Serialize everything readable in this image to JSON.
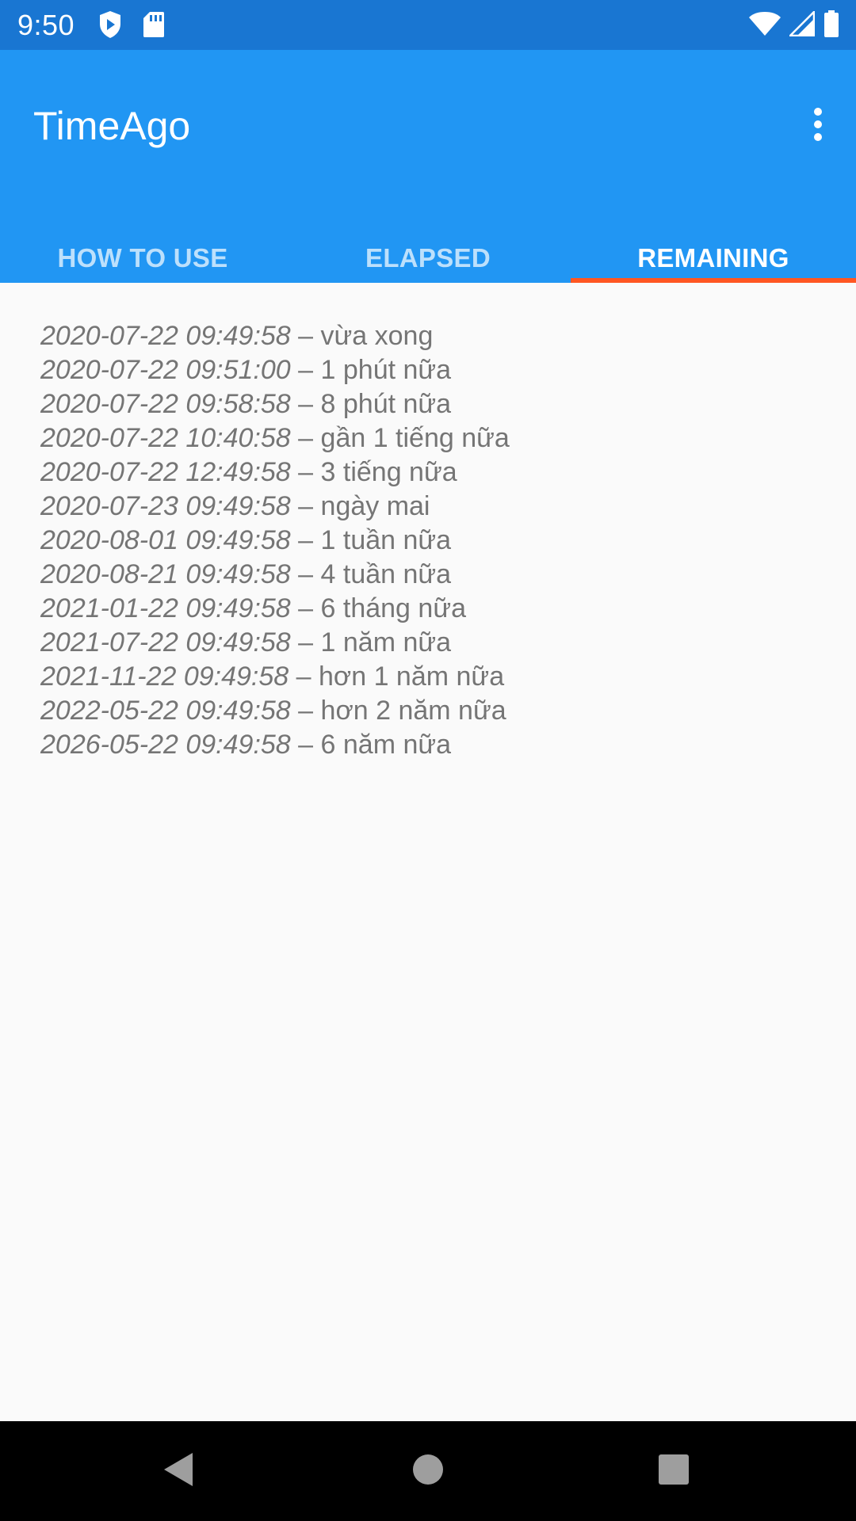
{
  "status_bar": {
    "time": "9:50",
    "left_icons": [
      "shield-play-icon",
      "sd-card-icon"
    ],
    "right_icons": [
      "wifi-icon",
      "cell-signal-icon",
      "battery-icon"
    ]
  },
  "app_bar": {
    "title": "TimeAgo",
    "overflow_icon": "more-vert-icon"
  },
  "tabs": [
    {
      "label": "HOW TO USE",
      "selected": false
    },
    {
      "label": "ELAPSED",
      "selected": false
    },
    {
      "label": "REMAINING",
      "selected": true
    }
  ],
  "colors": {
    "status_bar": "#1976d2",
    "primary": "#2196f3",
    "tab_indicator": "#ff5722",
    "list_text": "#757575",
    "background": "#fafafa"
  },
  "remaining_list": [
    {
      "date": "2020-07-22 09:49:58",
      "separator": " – ",
      "text": "vừa xong"
    },
    {
      "date": "2020-07-22 09:51:00",
      "separator": " – ",
      "text": "1 phút nữa"
    },
    {
      "date": "2020-07-22 09:58:58",
      "separator": " – ",
      "text": "8 phút nữa"
    },
    {
      "date": "2020-07-22 10:40:58",
      "separator": " – ",
      "text": "gần 1 tiếng nữa"
    },
    {
      "date": "2020-07-22 12:49:58",
      "separator": " – ",
      "text": "3 tiếng nữa"
    },
    {
      "date": "2020-07-23 09:49:58",
      "separator": " – ",
      "text": "ngày mai"
    },
    {
      "date": "2020-08-01 09:49:58",
      "separator": " – ",
      "text": "1 tuần nữa"
    },
    {
      "date": "2020-08-21 09:49:58",
      "separator": " – ",
      "text": "4 tuần nữa"
    },
    {
      "date": "2021-01-22 09:49:58",
      "separator": " – ",
      "text": "6 tháng nữa"
    },
    {
      "date": "2021-07-22 09:49:58",
      "separator": " – ",
      "text": "1 năm nữa"
    },
    {
      "date": "2021-11-22 09:49:58",
      "separator": " – ",
      "text": "hơn 1 năm nữa"
    },
    {
      "date": "2022-05-22 09:49:58",
      "separator": " – ",
      "text": "hơn 2 năm nữa"
    },
    {
      "date": "2026-05-22 09:49:58",
      "separator": " – ",
      "text": "6 năm nữa"
    }
  ],
  "nav_bar": {
    "buttons": [
      "back-icon",
      "home-icon",
      "recents-icon"
    ]
  }
}
